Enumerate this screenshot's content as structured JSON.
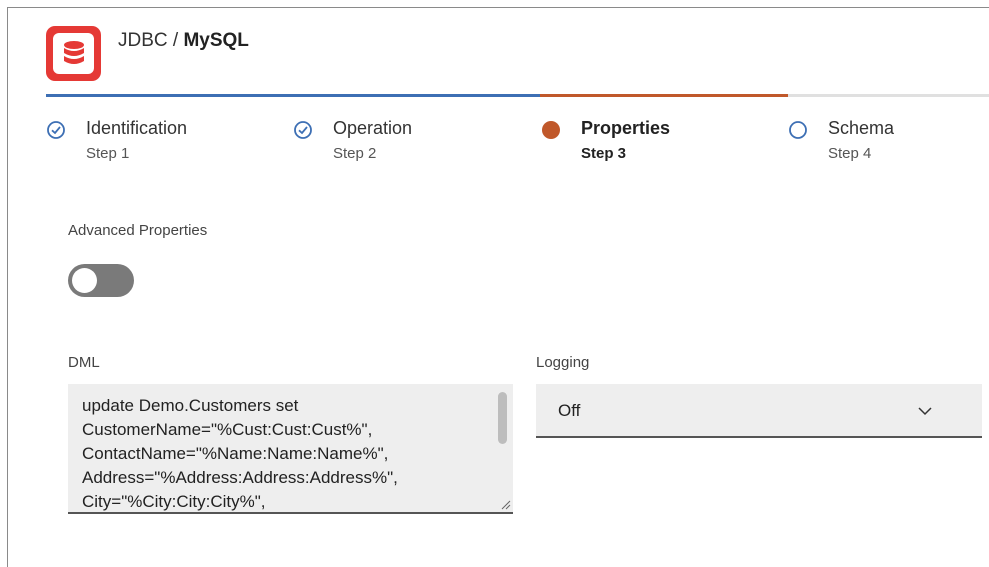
{
  "header": {
    "icon": "database-icon",
    "brand_color": "#e53935",
    "title_prefix": "JDBC / ",
    "title_bold": "MySQL"
  },
  "progress": {
    "done_color": "#3d6fb4",
    "active_color": "#c0582a"
  },
  "steps": [
    {
      "label": "Identification",
      "sub": "Step 1",
      "state": "complete",
      "icon": "check-circle-icon"
    },
    {
      "label": "Operation",
      "sub": "Step 2",
      "state": "complete",
      "icon": "check-circle-icon"
    },
    {
      "label": "Properties",
      "sub": "Step 3",
      "state": "current",
      "icon": "filled-circle-icon"
    },
    {
      "label": "Schema",
      "sub": "Step 4",
      "state": "pending",
      "icon": "empty-circle-icon"
    }
  ],
  "advanced": {
    "label": "Advanced Properties",
    "enabled": false
  },
  "dml": {
    "label": "DML",
    "value": "update Demo.Customers set\nCustomerName=\"%Cust:Cust:Cust%\",\nContactName=\"%Name:Name:Name%\",\nAddress=\"%Address:Address:Address%\",\nCity=\"%City:City:City%\","
  },
  "logging": {
    "label": "Logging",
    "value": "Off"
  }
}
